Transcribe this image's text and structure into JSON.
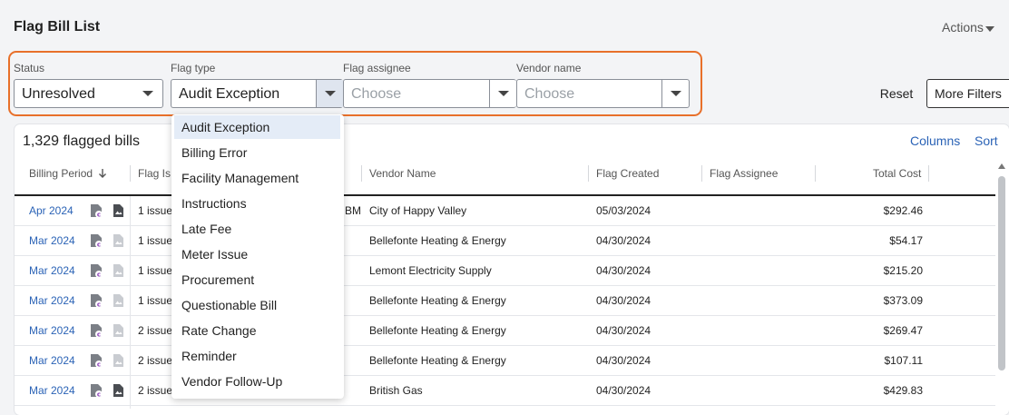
{
  "header": {
    "title": "Flag Bill List",
    "actions_label": "Actions"
  },
  "filters": {
    "status": {
      "label": "Status",
      "value": "Unresolved"
    },
    "flag_type": {
      "label": "Flag type",
      "value": "Audit Exception"
    },
    "flag_assignee": {
      "label": "Flag assignee",
      "placeholder": "Choose"
    },
    "vendor_name": {
      "label": "Vendor name",
      "placeholder": "Choose"
    },
    "reset_label": "Reset",
    "more_filters_label": "More Filters"
  },
  "table": {
    "count_label": "1,329 flagged bills",
    "columns_link": "Columns",
    "sort_link": "Sort",
    "headers": {
      "billing_period": "Billing Period",
      "flag_issue": "Flag Is",
      "vendor_name": "Vendor Name",
      "flag_created": "Flag Created",
      "flag_assignee": "Flag Assignee",
      "total_cost": "Total Cost"
    },
    "rows": [
      {
        "period": "Apr 2024",
        "issues": "1 issue",
        "vendor": "City of Happy Valley",
        "created": "05/03/2024",
        "cost": "$292.46",
        "partial": "BME"
      },
      {
        "period": "Mar 2024",
        "issues": "1 issue",
        "vendor": "Bellefonte Heating & Energy",
        "created": "04/30/2024",
        "cost": "$54.17"
      },
      {
        "period": "Mar 2024",
        "issues": "1 issue",
        "vendor": "Lemont Electricity Supply",
        "created": "04/30/2024",
        "cost": "$215.20"
      },
      {
        "period": "Mar 2024",
        "issues": "1 issue",
        "vendor": "Bellefonte Heating & Energy",
        "created": "04/30/2024",
        "cost": "$373.09"
      },
      {
        "period": "Mar 2024",
        "issues": "2 issue",
        "vendor": "Bellefonte Heating & Energy",
        "created": "04/30/2024",
        "cost": "$269.47"
      },
      {
        "period": "Mar 2024",
        "issues": "2 issue",
        "vendor": "Bellefonte Heating & Energy",
        "created": "04/30/2024",
        "cost": "$107.11"
      },
      {
        "period": "Mar 2024",
        "issues": "2 issue",
        "vendor": "British Gas",
        "created": "04/30/2024",
        "cost": "$429.83"
      }
    ]
  },
  "flag_type_options": [
    "Audit Exception",
    "Billing Error",
    "Facility Management",
    "Instructions",
    "Late Fee",
    "Meter Issue",
    "Procurement",
    "Questionable Bill",
    "Rate Change",
    "Reminder",
    "Vendor Follow-Up"
  ],
  "icons": {
    "sort_icon": "arrow-down-icon",
    "doc_icon": "document-currency-icon",
    "image_icon": "image-file-icon"
  },
  "colors": {
    "accent": "#e8702a",
    "link": "#2b63b6",
    "doc_icon": "#7b7f86",
    "badge": "#8a3ab9"
  }
}
